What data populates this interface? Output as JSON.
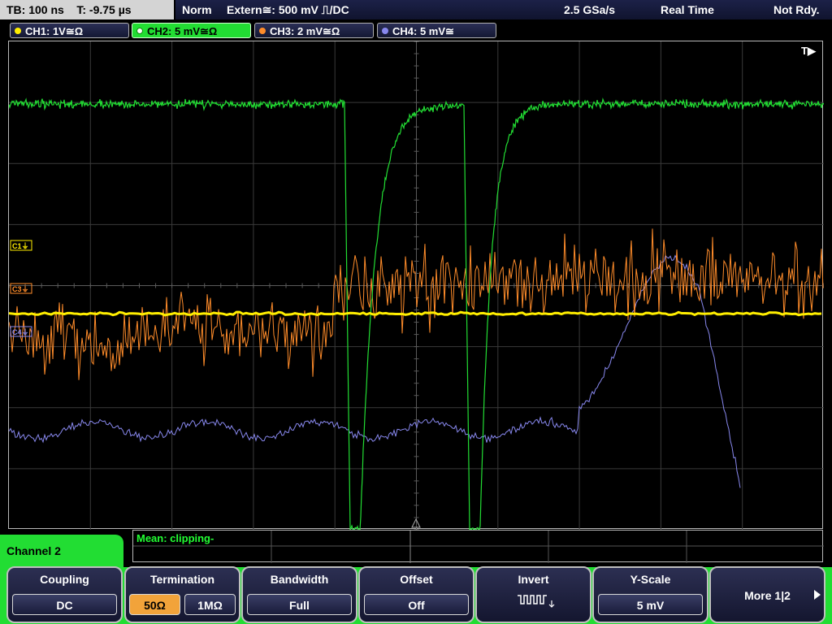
{
  "status": {
    "timebase": "TB: 100 ns",
    "trigger_pos": "T: -9.75 µs",
    "mode": "Norm",
    "source": "Extern≅: 500 mV ⎍/DC",
    "sample_rate": "2.5 GSa/s",
    "acq_mode": "Real Time",
    "state": "Not Rdy."
  },
  "channels": [
    {
      "label": "CH1: 1V≅Ω",
      "color": "#ffee00"
    },
    {
      "label": "CH2: 5 mV≅Ω",
      "color": "#22dd33"
    },
    {
      "label": "CH3: 2 mV≅Ω",
      "color": "#ff8c2a"
    },
    {
      "label": "CH4: 5 mV≅",
      "color": "#8888ee"
    }
  ],
  "markers": {
    "c1": "C1⏚",
    "c3": "C3⏚",
    "c4": "C4⏚",
    "trigger": "T▶"
  },
  "measurement": {
    "text": "Mean: clipping-"
  },
  "menu": {
    "title": "Channel 2",
    "softkeys": {
      "coupling": {
        "label": "Coupling",
        "value": "DC"
      },
      "termination": {
        "label": "Termination",
        "opt1": "50Ω",
        "opt2": "1MΩ"
      },
      "bandwidth": {
        "label": "Bandwidth",
        "value": "Full"
      },
      "offset": {
        "label": "Offset",
        "value": "Off"
      },
      "invert": {
        "label": "Invert"
      },
      "yscale": {
        "label": "Y-Scale",
        "value": "5 mV"
      },
      "more": {
        "label": "More 1|2"
      }
    }
  }
}
